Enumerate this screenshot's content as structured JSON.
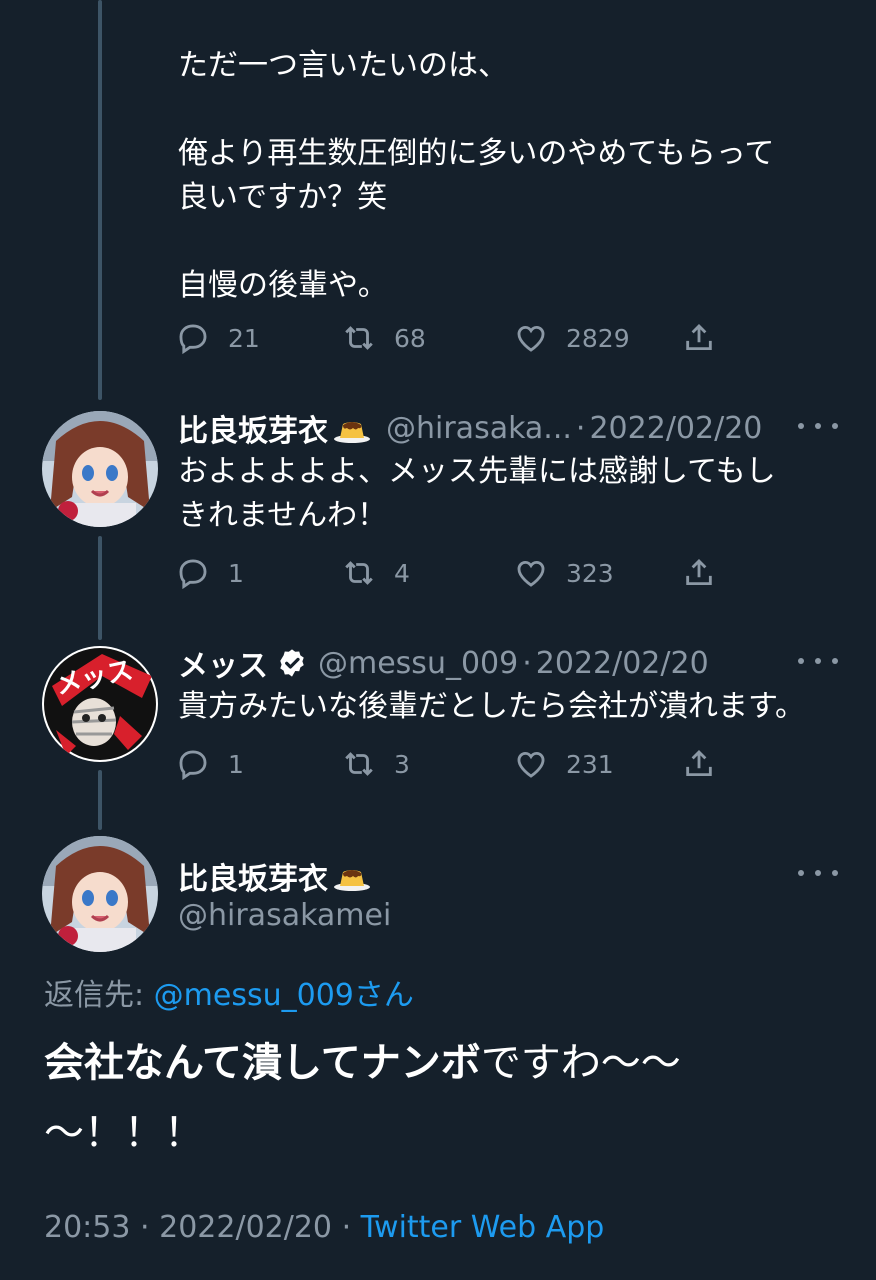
{
  "tweet1": {
    "text": "ただ一つ言いたいのは、\n\n俺より再生数圧倒的に多いのやめてもらって\n良いですか？笑\n\n自慢の後輩や。",
    "replies": "21",
    "retweets": "68",
    "likes": "2829"
  },
  "tweet2": {
    "name": "比良坂芽衣",
    "handle": "@hirasaka...",
    "date": "2022/02/20",
    "text": "およよよよよ、メッス先輩には感謝してもし\nきれませんわ！",
    "replies": "1",
    "retweets": "4",
    "likes": "323"
  },
  "tweet3": {
    "name": "メッス",
    "handle": "@messu_009",
    "date": "2022/02/20",
    "text": "貴方みたいな後輩だとしたら会社が潰れます。",
    "replies": "1",
    "retweets": "3",
    "likes": "231"
  },
  "main": {
    "name": "比良坂芽衣",
    "handle": "@hirasakamei",
    "reply_prefix": "返信先:",
    "reply_to": "@messu_009",
    "reply_suffix": "さん",
    "text_bold": "会社なんて潰してナンボ",
    "text_rest": "ですわ〜〜\n〜！！！",
    "time": "20:53",
    "date": "2022/02/20",
    "client": "Twitter Web App"
  },
  "separator": "·",
  "colors": {
    "background": "#15202b",
    "secondary_text": "#8b98a5",
    "link": "#1d9bf0",
    "thread_line": "#3d5466"
  },
  "icons": [
    "reply-icon",
    "retweet-icon",
    "like-icon",
    "share-icon",
    "more-icon",
    "verified-badge-icon",
    "pudding-emoji-icon"
  ]
}
